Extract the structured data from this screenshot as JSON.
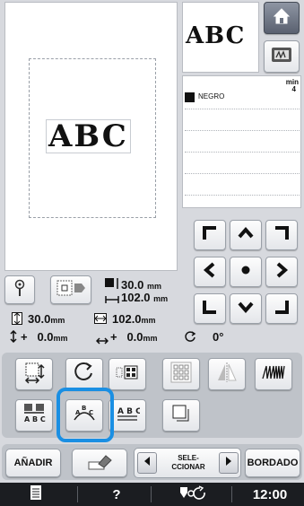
{
  "preview": {
    "design_text": "ABC"
  },
  "thumbnail": {
    "design_text": "ABC"
  },
  "color_list": {
    "min_label": "min",
    "items": [
      {
        "color": "#111111",
        "name": "NEGRO",
        "minutes": "4"
      }
    ]
  },
  "size_info": {
    "height": "30.0",
    "width": "102.0",
    "vertical": "30.0",
    "horizontal": "102.0",
    "unit": "mm",
    "offset_x": "0.0",
    "offset_y": "0.0",
    "rotation": "0°",
    "plus": "+"
  },
  "buttons": {
    "add": "AÑADIR",
    "select": "SELE-\nCCIONAR",
    "embroider": "BORDADO"
  },
  "status_bar": {
    "help": "?",
    "time": "12:00"
  },
  "accent_color": "#1a8fe3"
}
